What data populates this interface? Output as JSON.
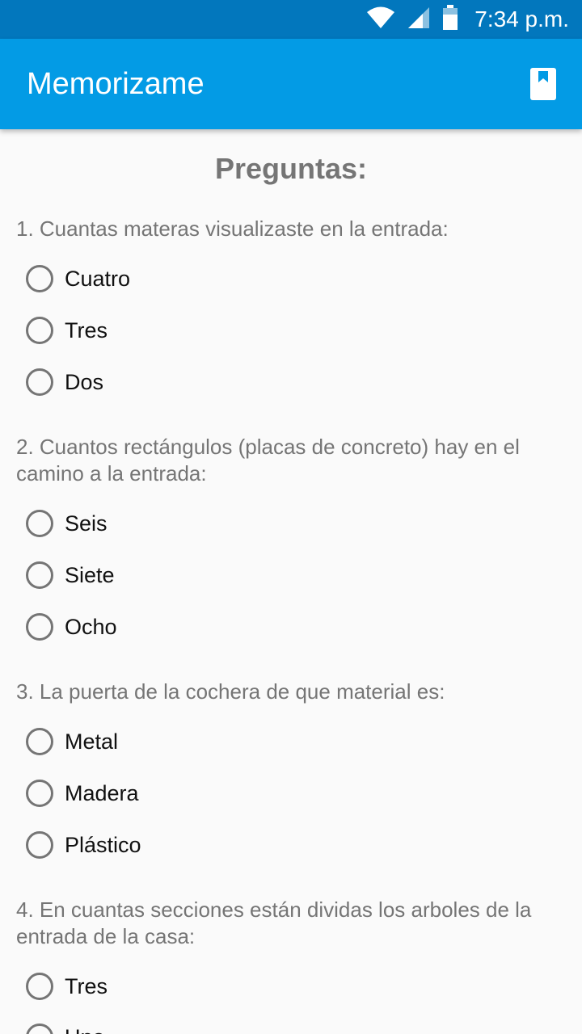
{
  "status_bar": {
    "time": "7:34 p.m.",
    "icons": [
      "wifi-icon",
      "signal-icon",
      "battery-icon"
    ]
  },
  "app_bar": {
    "title": "Memorizame",
    "action_icon": "bookmark-icon"
  },
  "main": {
    "heading": "Preguntas:",
    "questions": [
      {
        "text": "1. Cuantas materas visualizaste en la entrada:",
        "options": [
          "Cuatro",
          "Tres",
          "Dos"
        ]
      },
      {
        "text": "2. Cuantos rectángulos (placas de concreto) hay en el camino a la entrada:",
        "options": [
          "Seis",
          "Siete",
          "Ocho"
        ]
      },
      {
        "text": "3. La puerta de la cochera de que material es:",
        "options": [
          "Metal",
          "Madera",
          "Plástico"
        ]
      },
      {
        "text": "4. En cuantas secciones están dividas los arboles de la entrada de la casa:",
        "options": [
          "Tres",
          "Uno"
        ]
      }
    ]
  },
  "colors": {
    "status_bar": "#0277bd",
    "app_bar": "#039be5",
    "background": "#fafafa",
    "question_text": "#757575",
    "option_text": "#111111"
  }
}
